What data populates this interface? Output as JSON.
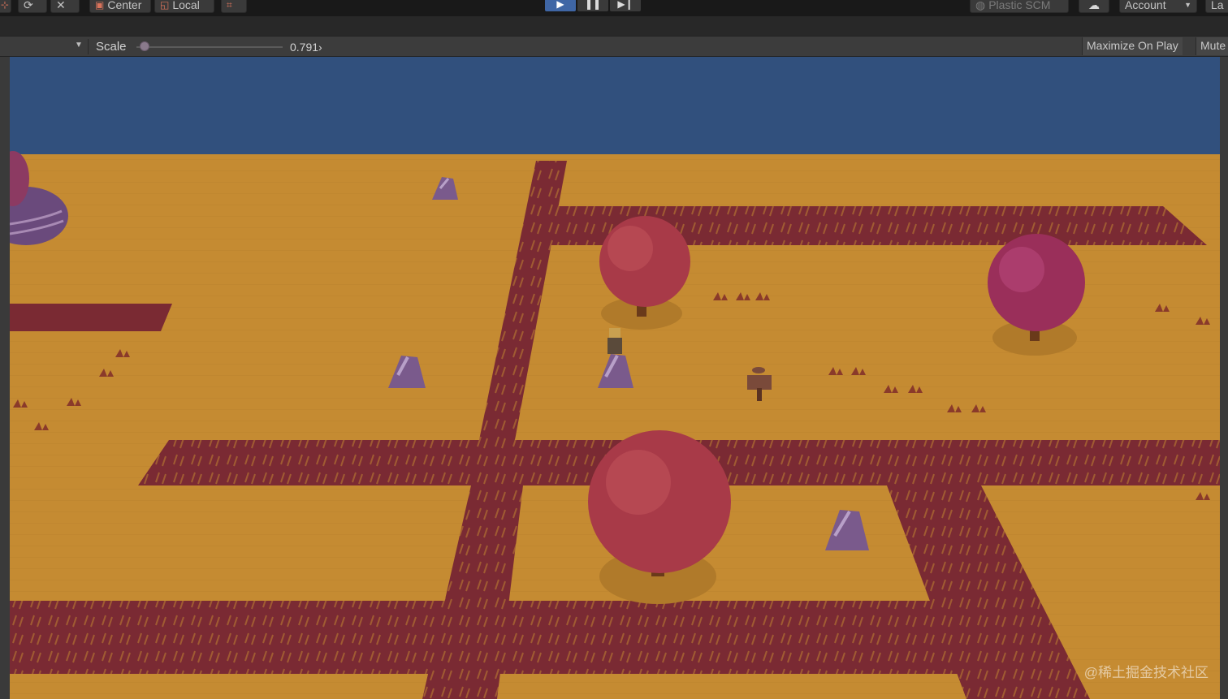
{
  "toolbar": {
    "tools": [
      {
        "name": "center-pivot-button",
        "label": "Center",
        "icon": "pivot-center-icon"
      },
      {
        "name": "local-space-button",
        "label": "Local",
        "icon": "space-local-icon"
      }
    ],
    "plastic_scm_label": "Plastic SCM",
    "account_label": "Account",
    "layout_label": "La"
  },
  "game_view": {
    "scale_label": "Scale",
    "scale_value": "0.791›",
    "scale_fraction": 0.04,
    "maximize_label": "Maximize On Play",
    "mute_label": "Mute"
  },
  "watermark": "@稀土掘金技术社区",
  "colors": {
    "sky": "#31507d",
    "ground": "#c58b32",
    "path": "#7a2a33",
    "tree": "#a83a48",
    "tree_purple": "#9a2f5a",
    "rock": "#7a5a8c",
    "play_active": "#3f66a5"
  }
}
